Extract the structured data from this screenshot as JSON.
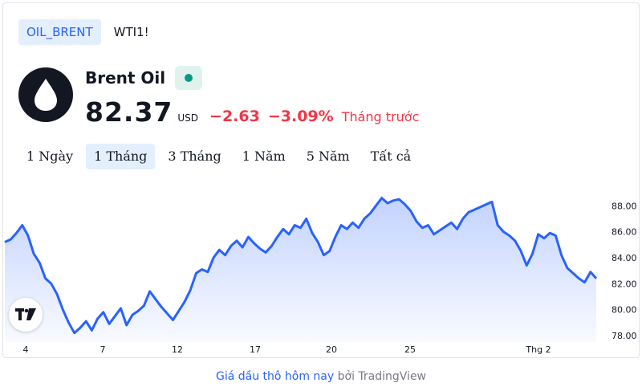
{
  "symbol_tabs": [
    {
      "label": "OIL_BRENT",
      "active": true
    },
    {
      "label": "WTI1!",
      "active": false
    }
  ],
  "symbol": {
    "name": "Brent Oil",
    "logo_icon": "oil-drop-icon",
    "market_status_color": "#089981",
    "price": "82.37",
    "currency": "USD",
    "change": "−2.63",
    "change_percent": "−3.09%",
    "period_label": "Tháng trước"
  },
  "range_tabs": [
    {
      "label": "1 Ngày",
      "active": false
    },
    {
      "label": "1 Tháng",
      "active": true
    },
    {
      "label": "3 Tháng",
      "active": false
    },
    {
      "label": "1 Năm",
      "active": false
    },
    {
      "label": "5 Năm",
      "active": false
    },
    {
      "label": "Tất cả",
      "active": false
    }
  ],
  "chart_data": {
    "type": "area",
    "x_ticks": [
      "4",
      "7",
      "12",
      "17",
      "20",
      "25",
      "Thg 2"
    ],
    "y_ticks": [
      "88.00",
      "86.00",
      "84.00",
      "82.00",
      "80.00",
      "78.00"
    ],
    "ylim": [
      77.5,
      89.5
    ],
    "series_color": "#2962ff",
    "values": [
      85.2,
      85.4,
      85.9,
      86.5,
      85.7,
      84.3,
      83.6,
      82.4,
      82.0,
      81.2,
      80.0,
      79.0,
      78.2,
      78.6,
      79.1,
      78.4,
      79.3,
      79.8,
      78.9,
      79.5,
      80.1,
      78.8,
      79.6,
      79.9,
      80.3,
      81.4,
      80.8,
      80.2,
      79.7,
      79.2,
      79.9,
      80.6,
      81.5,
      82.8,
      83.1,
      82.9,
      84.0,
      84.6,
      84.2,
      84.9,
      85.3,
      84.8,
      85.6,
      85.1,
      84.7,
      84.4,
      84.9,
      85.6,
      86.2,
      85.8,
      86.5,
      86.3,
      87.0,
      85.9,
      85.2,
      84.2,
      84.5,
      85.6,
      86.5,
      86.2,
      86.7,
      86.3,
      87.0,
      87.4,
      88.0,
      88.6,
      88.2,
      88.4,
      88.5,
      88.1,
      87.6,
      86.8,
      86.3,
      86.5,
      85.8,
      86.1,
      86.4,
      86.7,
      86.2,
      87.0,
      87.5,
      87.7,
      87.9,
      88.1,
      88.3,
      86.5,
      86.0,
      85.7,
      85.3,
      84.5,
      83.4,
      84.3,
      85.8,
      85.5,
      85.9,
      85.7,
      84.2,
      83.2,
      82.8,
      82.4,
      82.1,
      82.9,
      82.4
    ],
    "title": "",
    "xlabel": "",
    "ylabel": ""
  },
  "tv_logo_icon": "tradingview-logo-icon",
  "footer": {
    "link_text": "Giá dầu thô hôm nay",
    "by_text": "bởi",
    "brand_text": "TradingView"
  }
}
